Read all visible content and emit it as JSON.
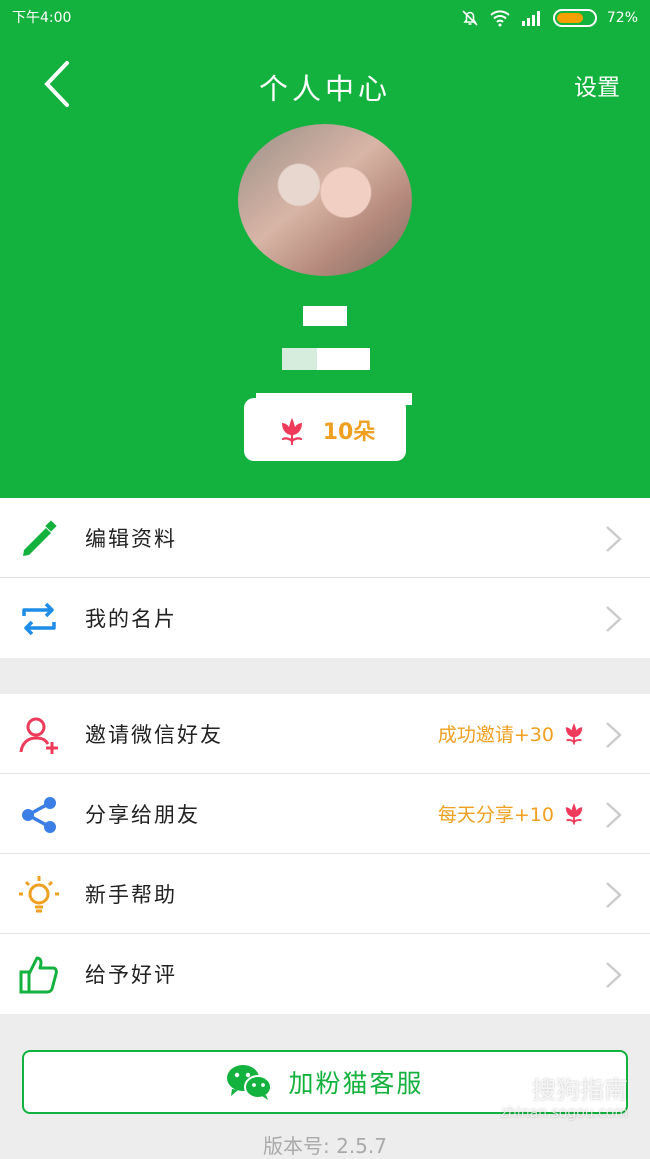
{
  "status_bar": {
    "time": "下午4:00",
    "battery": "72%",
    "battery_level": 0.72
  },
  "nav": {
    "title": "个人中心",
    "settings": "设置"
  },
  "profile": {
    "flowers_count": "10朵"
  },
  "menu_group_1": [
    {
      "label": "编辑资料",
      "icon": "pencil-icon"
    },
    {
      "label": "我的名片",
      "icon": "card-swap-icon"
    }
  ],
  "menu_group_2": [
    {
      "label": "邀请微信好友",
      "icon": "add-user-icon",
      "extra": "成功邀请+30"
    },
    {
      "label": "分享给朋友",
      "icon": "share-icon",
      "extra": "每天分享+10"
    },
    {
      "label": "新手帮助",
      "icon": "bulb-icon"
    },
    {
      "label": "给予好评",
      "icon": "thumbs-up-icon"
    }
  ],
  "kefu_button": "加粉猫客服",
  "version": "版本号: 2.5.7",
  "watermark": {
    "text": "搜狗指南",
    "url": "zhinan.sogou.com"
  },
  "colors": {
    "primary": "#13b13d",
    "accent": "#f0a020",
    "flower": "#ee3b5b"
  }
}
